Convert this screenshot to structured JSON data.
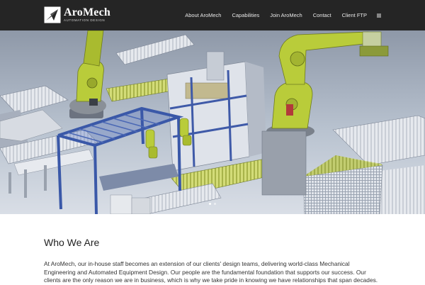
{
  "brand": {
    "name": "AroMech",
    "tagline": "AUTOMATION DESIGN"
  },
  "nav": {
    "items": [
      "About AroMech",
      "Capabilities",
      "Join AroMech",
      "Contact",
      "Client FTP"
    ],
    "menu_icon": "hamburger-icon"
  },
  "hero": {
    "slide_count": 2,
    "active_slide": 1
  },
  "about": {
    "title": "Who We Are",
    "body": "At AroMech, our in-house staff becomes an extension of our clients' design teams, delivering world-class Mechanical Engineering and Automated Equipment Design. Our people are the fundamental foundation that supports our success. Our clients are the only reason we are in business, which is why we take pride in knowing we have relationships that span decades."
  },
  "colors": {
    "header_bg": "#252525",
    "robot_arm": "#b9cc3a",
    "frame_blue": "#3a58a8"
  }
}
